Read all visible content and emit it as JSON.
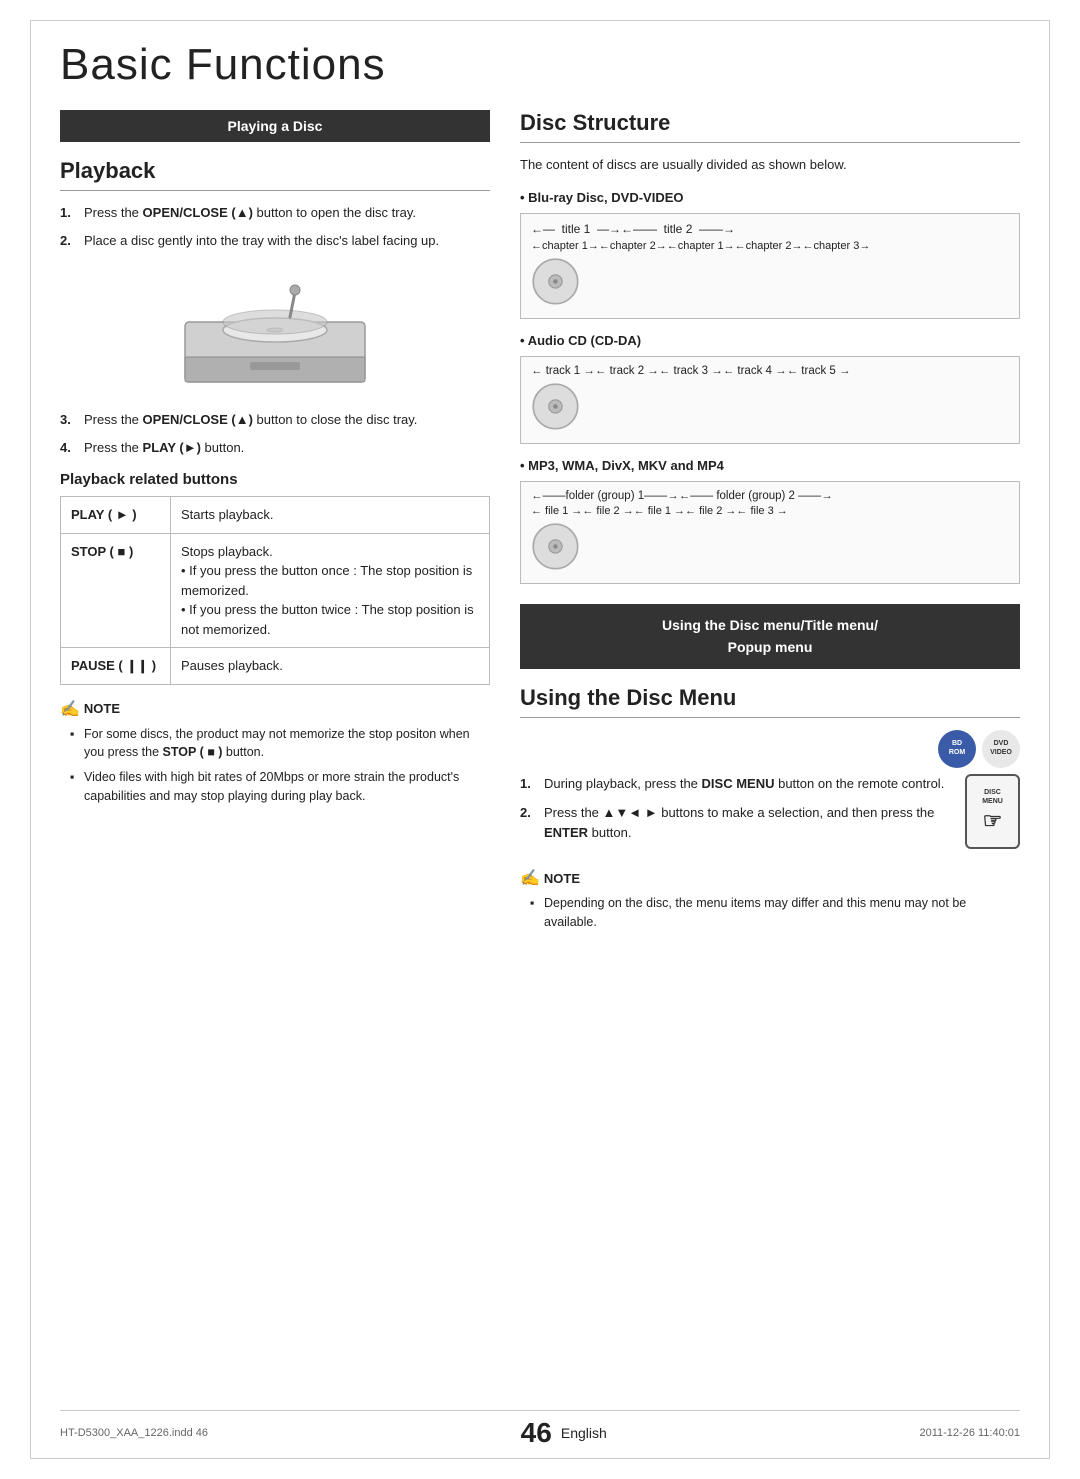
{
  "page": {
    "title": "Basic Functions",
    "number": "46",
    "language": "English",
    "footer_left": "HT-D5300_XAA_1226.indd   46",
    "footer_right": "2011-12-26   11:40:01"
  },
  "left": {
    "banner": "Playing a Disc",
    "playback_title": "Playback",
    "steps": [
      {
        "num": "1.",
        "text_before": "Press the ",
        "bold": "OPEN/CLOSE (▲)",
        "text_after": " button to open the disc tray."
      },
      {
        "num": "2.",
        "text_plain": "Place a disc gently into the tray with the disc's label facing up."
      },
      {
        "num": "3.",
        "text_before": "Press the ",
        "bold": "OPEN/CLOSE (▲)",
        "text_after": " button to close the disc tray."
      },
      {
        "num": "4.",
        "text_before": "Press the ",
        "bold": "PLAY (►)",
        "text_after": " button."
      }
    ],
    "playback_buttons_heading": "Playback related buttons",
    "table": [
      {
        "button": "PLAY ( ► )",
        "description": "Starts playback."
      },
      {
        "button": "STOP ( ■ )",
        "description_parts": [
          "Stops playback.",
          "• If you press the button once : The stop position is memorized.",
          "• If you press the button twice : The stop position is not memorized."
        ]
      },
      {
        "button": "PAUSE ( ❙❙ )",
        "description": "Pauses playback."
      }
    ],
    "note_title": "NOTE",
    "notes": [
      "For some discs, the product may not memorize the stop positon when you press the STOP ( ■ ) button.",
      "Video files with high bit rates of 20Mbps or more strain the product's capabilities and may stop playing during play back."
    ]
  },
  "right": {
    "disc_structure_title": "Disc Structure",
    "disc_structure_desc": "The content of discs are usually divided as shown below.",
    "formats": [
      {
        "name": "Blu-ray Disc, DVD-VIDEO",
        "type": "bd_dvd",
        "top_row": "←—  title 1  —→←——  title 2  ——→",
        "bottom_row": "←chapter 1→←chapter 2→←chapter 1→←chapter 2→←chapter 3→"
      },
      {
        "name": "Audio CD (CD-DA)",
        "type": "cd",
        "row": "← track 1 →← track 2 →← track 3 →← track 4 →← track 5 →"
      },
      {
        "name": "MP3, WMA, DivX, MKV and MP4",
        "type": "mp3",
        "top_row": "←——folder (group) 1——→←——  folder (group) 2  ——→",
        "bottom_row": "← file 1 →← file 2 →← file 1 →← file 2 →← file 3 →"
      }
    ],
    "disc_menu_banner_line1": "Using the Disc menu/Title menu/",
    "disc_menu_banner_line2": "Popup menu",
    "using_disc_menu_title": "Using the Disc Menu",
    "disc_menu_steps": [
      {
        "num": "1.",
        "text_before": "During playback, press the ",
        "bold": "DISC MENU",
        "text_after": " button on the remote control."
      },
      {
        "num": "2.",
        "text_before": "Press the ▲▼◄ ► buttons to make a selection, and then press the ",
        "bold": "ENTER",
        "text_after": " button."
      }
    ],
    "disc_menu_notes": [
      "Depending on the disc, the menu items may differ and this menu may not be available."
    ]
  }
}
